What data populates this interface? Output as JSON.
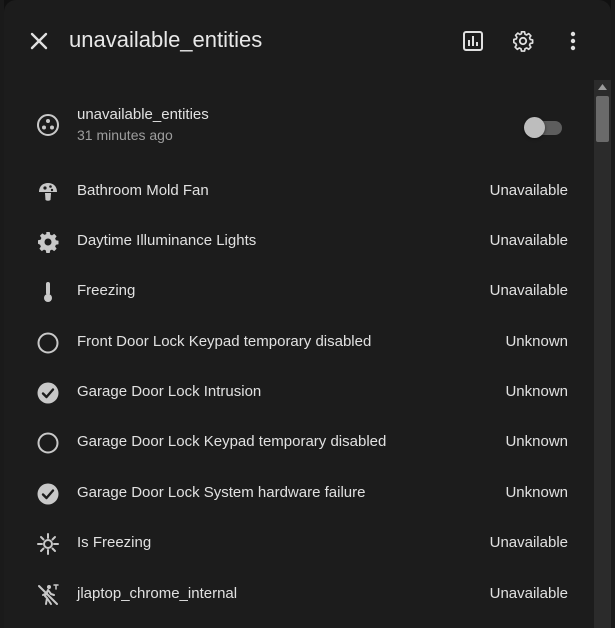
{
  "dialog": {
    "title": "unavailable_entities"
  },
  "toggle_row": {
    "name": "unavailable_entities",
    "subtitle": "31 minutes ago",
    "state": "off"
  },
  "entities": [
    {
      "name": "Bathroom Mold Fan",
      "state": "Unavailable",
      "icon": "mushroom-icon"
    },
    {
      "name": "Daytime Illuminance Lights",
      "state": "Unavailable",
      "icon": "gear-icon"
    },
    {
      "name": "Freezing",
      "state": "Unavailable",
      "icon": "thermometer-icon"
    },
    {
      "name": "Front Door Lock Keypad temporary disabled",
      "state": "Unknown",
      "icon": "circle-outline-icon"
    },
    {
      "name": "Garage Door Lock Intrusion",
      "state": "Unknown",
      "icon": "check-circle-icon"
    },
    {
      "name": "Garage Door Lock Keypad temporary disabled",
      "state": "Unknown",
      "icon": "circle-outline-icon"
    },
    {
      "name": "Garage Door Lock System hardware failure",
      "state": "Unknown",
      "icon": "check-circle-icon"
    },
    {
      "name": "Is Freezing",
      "state": "Unavailable",
      "icon": "snowflake-sun-icon"
    },
    {
      "name": "jlaptop_chrome_internal",
      "state": "Unavailable",
      "icon": "walk-off-icon"
    }
  ],
  "colors": {
    "background": "#111111",
    "dialog": "#1c1c1c",
    "text": "#e1e1e1",
    "secondary_text": "#9e9e9e",
    "icon": "#c8c8c8"
  }
}
